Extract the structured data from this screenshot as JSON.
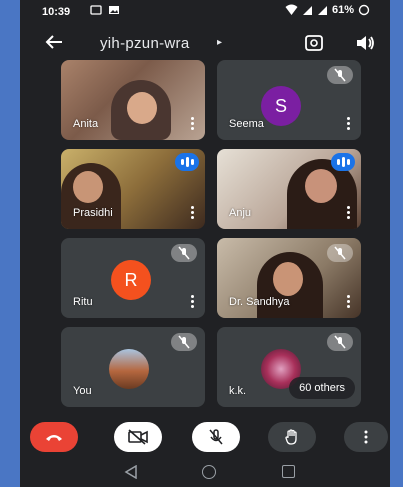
{
  "status": {
    "time": "10:39",
    "battery": "61%"
  },
  "header": {
    "meeting_code": "yih-pzun-wra",
    "caret": "▸"
  },
  "tiles": [
    {
      "name": "Anita",
      "type": "video",
      "indicator": "none"
    },
    {
      "name": "Seema",
      "type": "avatar",
      "initial": "S",
      "avatar_color": "#7b1fa2",
      "indicator": "muted"
    },
    {
      "name": "Prasidhi",
      "type": "video",
      "indicator": "speaking"
    },
    {
      "name": "Anju",
      "type": "video",
      "indicator": "speaking"
    },
    {
      "name": "Ritu",
      "type": "avatar",
      "initial": "R",
      "avatar_color": "#f4511e",
      "indicator": "muted"
    },
    {
      "name": "Dr. Sandhya",
      "type": "video",
      "indicator": "muted"
    },
    {
      "name": "You",
      "type": "photo-avatar",
      "indicator": "muted"
    },
    {
      "name": "k.k.",
      "type": "photo-avatar",
      "indicator": "muted"
    }
  ],
  "others": "60 others",
  "controls": {
    "end_call_color": "#ea4335",
    "accent": "#1a73e8"
  }
}
